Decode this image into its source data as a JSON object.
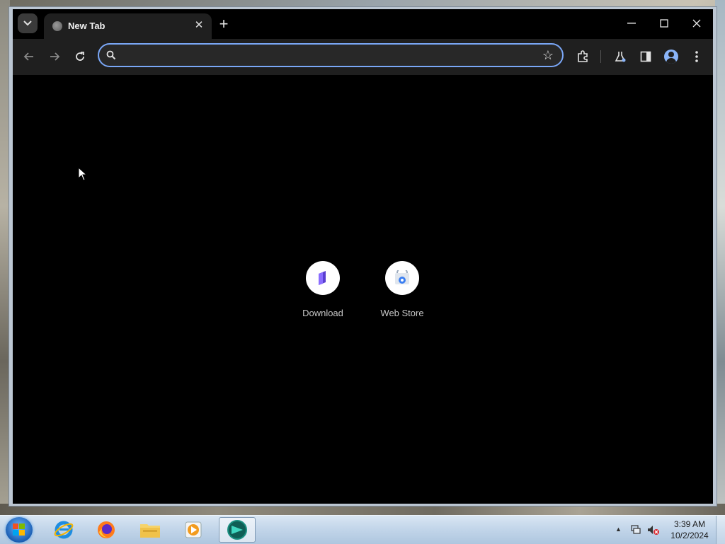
{
  "browser": {
    "tab": {
      "title": "New Tab"
    },
    "omnibox": {
      "value": "",
      "placeholder": ""
    },
    "accent": "#7aa7f7"
  },
  "shortcuts": [
    {
      "label": "Download",
      "icon": "download-app-icon"
    },
    {
      "label": "Web Store",
      "icon": "web-store-icon"
    }
  ],
  "taskbar": {
    "apps": [
      "start-button",
      "internet-explorer-icon",
      "firefox-icon",
      "file-explorer-icon",
      "media-player-icon",
      "browser-app-icon"
    ],
    "clock": {
      "time": "3:39 AM",
      "date": "10/2/2024"
    }
  }
}
